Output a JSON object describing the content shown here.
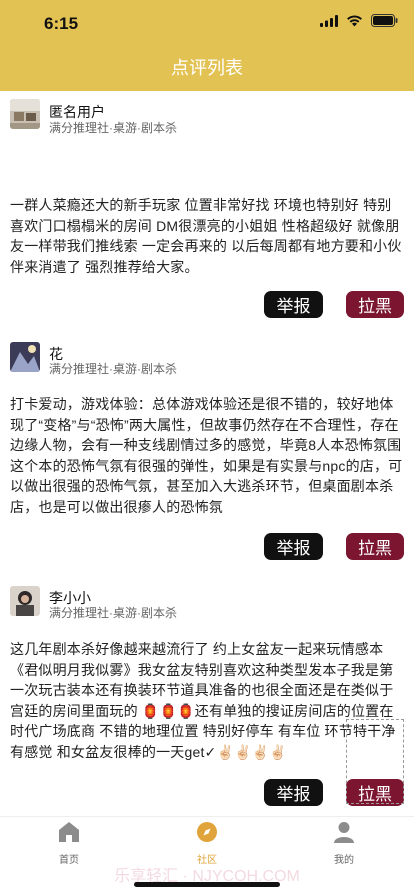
{
  "status": {
    "time": "6:15"
  },
  "header": {
    "title": "点评列表"
  },
  "reviews": [
    {
      "username": "匿名用户",
      "store": "满分推理社·桌游·剧本杀",
      "content": "一群人菜瘾还大的新手玩家  位置非常好找  环境也特别好  特别喜欢门口榻榻米的房间  DM很漂亮的小姐姐 性格超级好 就像朋友一样带我们推线索  一定会再来的  以后每周都有地方要和小伙伴来消遣了  强烈推荐给大家。",
      "report_label": "举报",
      "block_label": "拉黑"
    },
    {
      "username": "花",
      "store": "满分推理社·桌游·剧本杀",
      "content": "打卡爱动，游戏体验：总体游戏体验还是很不错的，较好地体现了“变格”与“恐怖”两大属性，但故事仍然存在不合理性，存在边缘人物，会有一种支线剧情过多的感觉，毕竟8人本恐怖氛围这个本的恐怖气氛有很强的弹性，如果是有实景与npc的店，可以做出很强的恐怖气氛，甚至加入大逃杀环节，但桌面剧本杀店，也是可以做出很瘆人的恐怖氛",
      "report_label": "举报",
      "block_label": "拉黑"
    },
    {
      "username": "李小小",
      "store": "满分推理社·桌游·剧本杀",
      "content": "这几年剧本杀好像越来越流行了 约上女盆友一起来玩情感本《君似明月我似雾》我女盆友特别喜欢这种类型发本子我是第一次玩古装本还有换装环节道具准备的也很全面还是在类似于宫廷的房间里面玩的 🏮🏮🏮还有单独的搜证房间店的位置在时代广场底商 不错的地理位置 特别好停车 有车位 环节特干净有感觉 和女盆友很棒的一天get✓✌🏻✌🏻✌🏻✌🏻",
      "report_label": "举报",
      "block_label": "拉黑"
    }
  ],
  "tabbar": {
    "tabs": [
      {
        "label": "首页",
        "icon": "home-icon"
      },
      {
        "label": "社区",
        "icon": "compass-icon"
      },
      {
        "label": "我的",
        "icon": "person-icon"
      }
    ],
    "active": "社区"
  },
  "watermark": "乐享轻汇 · NJYCOH.COM",
  "colors": {
    "header": "#e3c254",
    "block_button": "#7b1530",
    "report_button": "#111111",
    "active_tab": "#e0a43a"
  }
}
